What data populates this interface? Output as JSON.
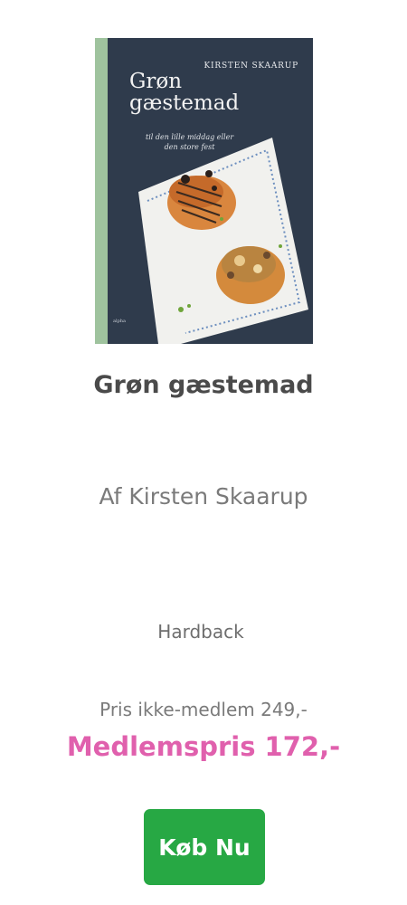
{
  "book": {
    "cover": {
      "author_text": "KIRSTEN SKAARUP",
      "title_text": "Grøn\ngæstemad",
      "subtitle_text": "til den lille middag eller\nden store fest",
      "publisher_text": "alpha"
    },
    "title": "Grøn gæstemad",
    "author": "Af Kirsten Skaarup",
    "format": "Hardback",
    "price_regular": "Pris ikke-medlem 249,-",
    "price_member": "Medlemspris 172,-",
    "buy_label": "Køb Nu"
  },
  "colors": {
    "member_price": "#e060ad",
    "buy_button": "#27a844",
    "title": "#4a4a4a"
  }
}
